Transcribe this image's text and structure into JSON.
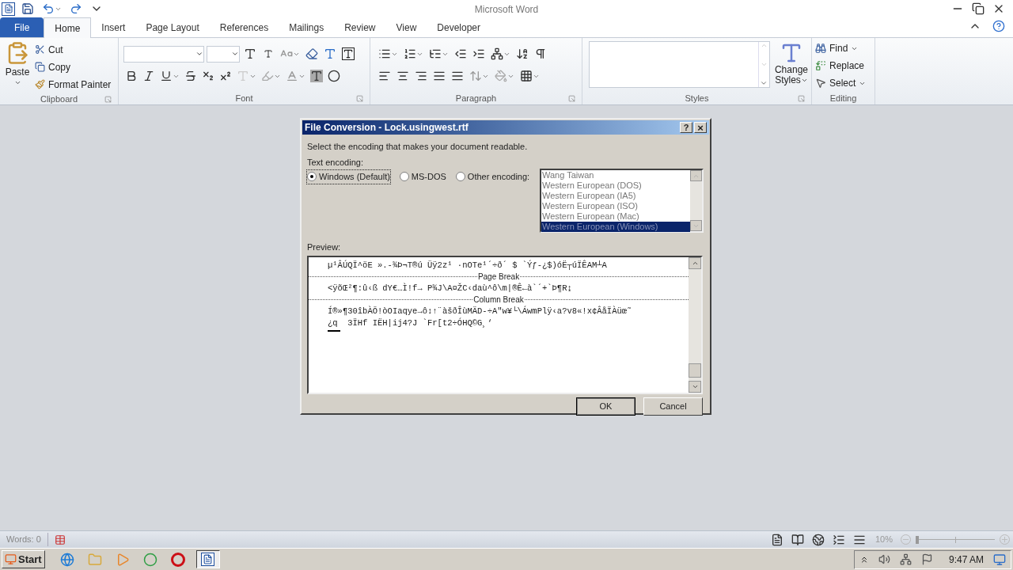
{
  "window": {
    "title": "Microsoft Word"
  },
  "ribbon_tabs": [
    {
      "label": "File",
      "kind": "file",
      "selected": false
    },
    {
      "label": "Home",
      "kind": "tab",
      "selected": true
    },
    {
      "label": "Insert",
      "kind": "tab",
      "selected": false
    },
    {
      "label": "Page Layout",
      "kind": "tab",
      "selected": false
    },
    {
      "label": "References",
      "kind": "tab",
      "selected": false
    },
    {
      "label": "Mailings",
      "kind": "tab",
      "selected": false
    },
    {
      "label": "Review",
      "kind": "tab",
      "selected": false
    },
    {
      "label": "View",
      "kind": "tab",
      "selected": false
    },
    {
      "label": "Developer",
      "kind": "tab",
      "selected": false
    }
  ],
  "clipboard": {
    "paste": "Paste",
    "cut": "Cut",
    "copy": "Copy",
    "format_painter": "Format Painter",
    "label": "Clipboard"
  },
  "font": {
    "label": "Font"
  },
  "paragraph": {
    "label": "Paragraph"
  },
  "styles": {
    "change_styles": [
      "Change",
      "Styles"
    ],
    "label": "Styles"
  },
  "editing": {
    "find": "Find",
    "replace": "Replace",
    "select": "Select",
    "label": "Editing"
  },
  "dialog": {
    "title": "File Conversion - Lock.usingwest.rtf",
    "help": "?",
    "close": "×",
    "instruction": "Select the encoding that makes your document readable.",
    "encoding_label": "Text encoding:",
    "options": [
      {
        "label": "Windows (Default)",
        "selected": true
      },
      {
        "label": "MS-DOS",
        "selected": false
      },
      {
        "label": "Other encoding:",
        "selected": false
      }
    ],
    "encodings": [
      {
        "label": "Wang Taiwan",
        "selected": false
      },
      {
        "label": "Western European (DOS)",
        "selected": false
      },
      {
        "label": "Western European (IA5)",
        "selected": false
      },
      {
        "label": "Western European (ISO)",
        "selected": false
      },
      {
        "label": "Western European (Mac)",
        "selected": false
      },
      {
        "label": "Western European (Windows)",
        "selected": true
      }
    ],
    "preview_label": "Preview:",
    "preview": [
      {
        "kind": "text",
        "text": "µ¹ÂÚQÏ^öE ».-¾Þ¬T®ú Üÿ2z¹ ·nOTe¹´÷ð´ $ `Ýƒ-¿$)óË┬úÏÊAM┴A"
      },
      {
        "kind": "break",
        "text": "Page Break"
      },
      {
        "kind": "text",
        "text": "<ÿõŒ²¶:û‹ß dY€…Ì!f→ P¾J\\A¤ŽC‹daù^ô\\m|®Ê←à`´+`Þ¶R↨"
      },
      {
        "kind": "break",
        "text": "Column Break"
      },
      {
        "kind": "text",
        "text": "Í®»¶30îbÀÕ!òOIaqye→ô↕↑¨àšðÎùMÄD-÷A\"w¥└\\ÁwmPlÿ‹a?v8«!x¢ÂåÏÀüœ˜"
      },
      {
        "kind": "text",
        "text": "¿q  3ÏHf IËH|ij4?J `Fr[t2÷ÓHQ©G¸‘"
      }
    ],
    "ok": "OK",
    "cancel": "Cancel"
  },
  "status_bar": {
    "words": "Words: 0",
    "zoom": "10%",
    "zoom_slider": {
      "level": 0
    }
  },
  "taskbar": {
    "start": "Start",
    "apps": [
      {
        "kind": "ie",
        "selected": false
      },
      {
        "kind": "explorer",
        "selected": false
      },
      {
        "kind": "media",
        "selected": false
      },
      {
        "kind": "chrome",
        "selected": false
      },
      {
        "kind": "opera",
        "selected": false
      },
      {
        "kind": "word",
        "selected": true
      }
    ],
    "time": "9:47 AM"
  }
}
